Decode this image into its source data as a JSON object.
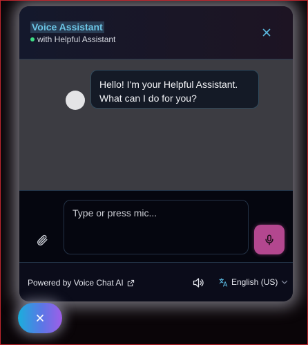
{
  "header": {
    "title": "Voice Assistant",
    "subtitle": "with Helpful Assistant",
    "close_icon": "close-icon"
  },
  "messages": [
    {
      "sender": "assistant",
      "text": "Hello! I'm your Helpful Assistant. What can I do for you?"
    }
  ],
  "composer": {
    "placeholder": "Type or press mic...",
    "value": "",
    "attach_icon": "paperclip-icon",
    "mic_icon": "microphone-icon"
  },
  "footer": {
    "powered_by": "Powered by Voice Chat AI",
    "external_icon": "external-link-icon",
    "speaker_icon": "speaker-icon",
    "language": "English (US)",
    "translate_icon": "translate-icon",
    "chevron_icon": "chevron-down-icon"
  },
  "fab": {
    "icon": "close-icon"
  },
  "colors": {
    "accent_title": "#6cc6e6",
    "status_online": "#3ddc84",
    "mic_button": "#b3478f",
    "bubble_bg": "#141a26",
    "messages_bg": "#3c3c42"
  }
}
